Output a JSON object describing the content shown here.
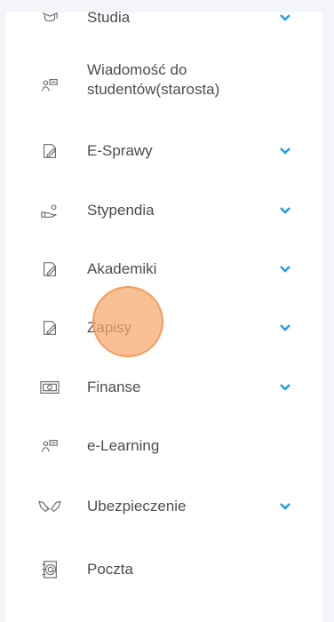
{
  "menu": {
    "accent": "#1e9de0",
    "items": [
      {
        "label": "Studia",
        "icon": "graduation-cap-icon",
        "chevron": true
      },
      {
        "label": "Wiadomość do studentów(starosta)",
        "icon": "announcement-icon",
        "chevron": false
      },
      {
        "label": "E-Sprawy",
        "icon": "edit-document-icon",
        "chevron": true
      },
      {
        "label": "Stypendia",
        "icon": "hand-money-icon",
        "chevron": true
      },
      {
        "label": "Akademiki",
        "icon": "edit-document-icon",
        "chevron": true
      },
      {
        "label": "Zapisy",
        "icon": "edit-document-icon",
        "chevron": true
      },
      {
        "label": "Finanse",
        "icon": "banknote-icon",
        "chevron": true
      },
      {
        "label": "e-Learning",
        "icon": "announcement-icon",
        "chevron": false
      },
      {
        "label": "Ubezpieczenie",
        "icon": "handshake-icon",
        "chevron": true
      },
      {
        "label": "Poczta",
        "icon": "mail-book-icon",
        "chevron": false
      }
    ]
  }
}
